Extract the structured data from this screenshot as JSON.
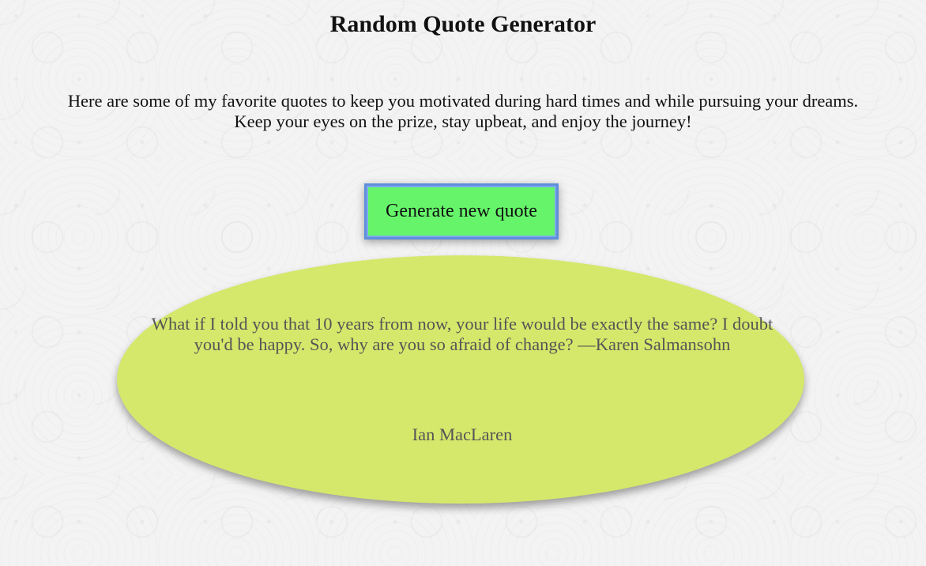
{
  "page": {
    "title": "Random Quote Generator",
    "intro_line1": "Here are some of my favorite quotes to keep you motivated during hard times and while pursuing your dreams.",
    "intro_line2": "Keep your eyes on the prize, stay upbeat, and enjoy the journey!"
  },
  "button": {
    "label": "Generate new quote"
  },
  "quote": {
    "text": "What if I told you that 10 years from now, your life would be exactly the same? I doubt you'd be happy. So, why are you so afraid of change? —Karen Salmansohn",
    "author": "Ian MacLaren"
  },
  "colors": {
    "button_bg": "#66f56a",
    "button_border": "#7da9ee",
    "card_bg": "#d5e86b",
    "quote_text": "#555555"
  }
}
